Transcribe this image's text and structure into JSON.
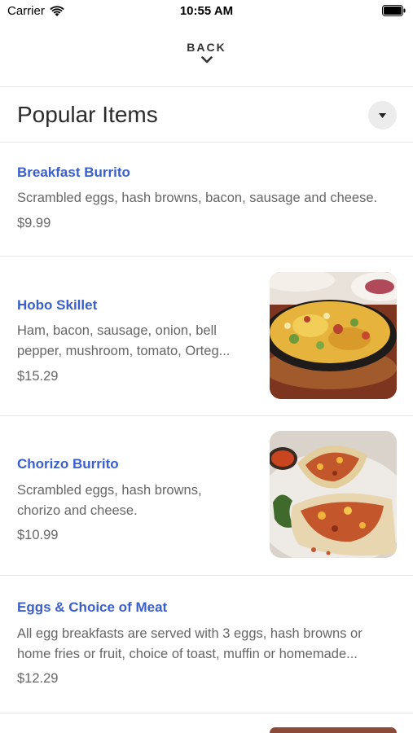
{
  "status_bar": {
    "carrier": "Carrier",
    "time": "10:55 AM"
  },
  "header": {
    "back_label": "BACK"
  },
  "section": {
    "title": "Popular Items"
  },
  "items": [
    {
      "name": "Breakfast Burrito",
      "description": "Scrambled eggs, hash browns, bacon, sausage and cheese.",
      "price": "$9.99"
    },
    {
      "name": "Hobo Skillet",
      "description_lines": [
        "Ham, bacon, sausage, onion, bell",
        "pepper, mushroom, tomato, Orteg..."
      ],
      "price": "$15.29",
      "image": "skillet-photo"
    },
    {
      "name": "Chorizo Burrito",
      "description_lines": [
        "Scrambled eggs, hash browns,",
        "chorizo and cheese."
      ],
      "price": "$10.99",
      "image": "burrito-photo"
    },
    {
      "name": "Eggs & Choice of Meat",
      "description_lines": [
        "All egg breakfasts are served with 3 eggs, hash browns or",
        "home fries or fruit, choice of toast, muffin or homemade..."
      ],
      "price": "$12.29"
    }
  ],
  "colors": {
    "item_name": "#3a5fcd",
    "text_secondary": "#666666",
    "divider": "#e6e6e6"
  }
}
